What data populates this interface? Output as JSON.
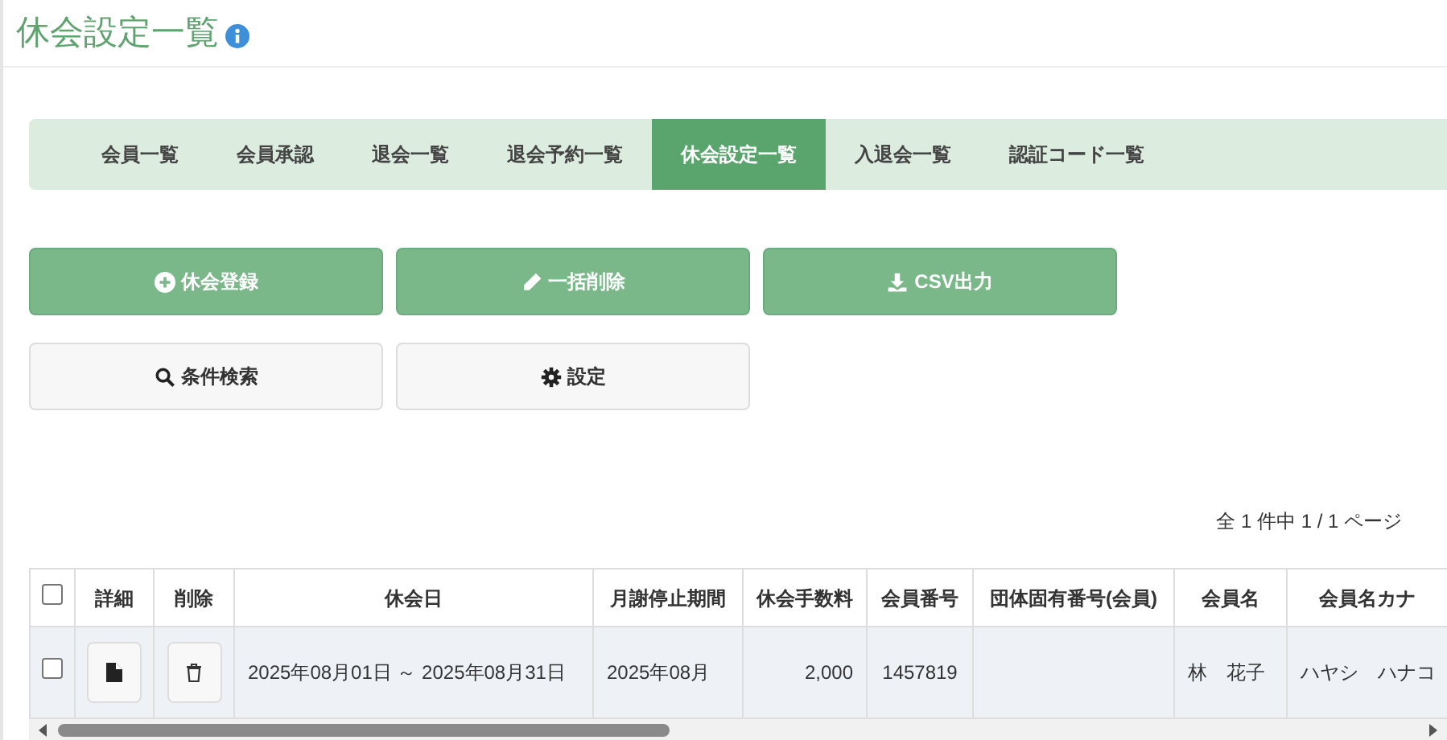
{
  "page_title": "休会設定一覧",
  "tabs": [
    {
      "label": "会員一覧",
      "selected": false
    },
    {
      "label": "会員承認",
      "selected": false
    },
    {
      "label": "退会一覧",
      "selected": false
    },
    {
      "label": "退会予約一覧",
      "selected": false
    },
    {
      "label": "休会設定一覧",
      "selected": true
    },
    {
      "label": "入退会一覧",
      "selected": false
    },
    {
      "label": "認証コード一覧",
      "selected": false
    }
  ],
  "actions": [
    {
      "label": "休会登録",
      "kind": "primary"
    },
    {
      "label": "一括削除",
      "kind": "primary"
    },
    {
      "label": "CSV出力",
      "kind": "primary"
    },
    {
      "label": "条件検索",
      "kind": "secondary"
    },
    {
      "label": "設定",
      "kind": "secondary"
    }
  ],
  "pagination": "全 1 件中 1 / 1 ページ",
  "table": {
    "columns": [
      {
        "kind": "checkbox",
        "checked": false
      },
      {
        "kind": "text",
        "label": "詳細"
      },
      {
        "kind": "text",
        "label": "削除"
      },
      {
        "kind": "text",
        "label": "休会日"
      },
      {
        "kind": "text",
        "label": "月謝停止期間"
      },
      {
        "kind": "text",
        "label": "休会手数料"
      },
      {
        "kind": "text",
        "label": "会員番号"
      },
      {
        "kind": "text",
        "label": "団体固有番号(会員)"
      },
      {
        "kind": "text",
        "label": "会員名"
      },
      {
        "kind": "text",
        "label": "会員名カナ"
      }
    ],
    "rows": [
      {
        "cells": [
          {
            "kind": "checkbox",
            "checked": false
          },
          {
            "kind": "detail"
          },
          {
            "kind": "delete"
          },
          {
            "kind": "text",
            "text": "2025年08月01日 ～ 2025年08月31日"
          },
          {
            "kind": "text",
            "text": "2025年08月"
          },
          {
            "kind": "number",
            "text": "2,000"
          },
          {
            "kind": "text",
            "text": "1457819"
          },
          {
            "kind": "text",
            "text": ""
          },
          {
            "kind": "text",
            "text": "林　花子"
          },
          {
            "kind": "text",
            "text": "ハヤシ　ハナコ"
          }
        ]
      }
    ]
  }
}
